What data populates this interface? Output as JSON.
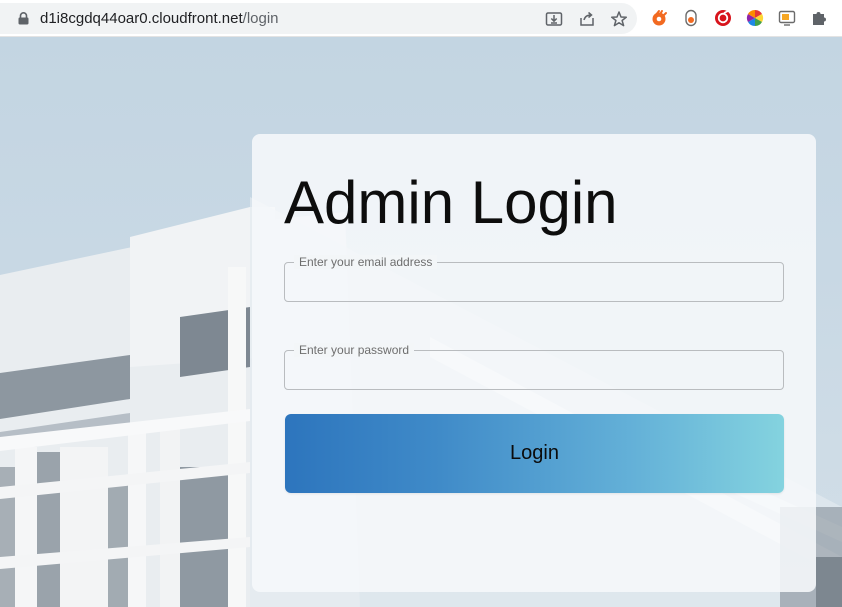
{
  "browser": {
    "url_host": "d1i8cgdq44oar0.cloudfront.net",
    "url_path": "/login",
    "icons": {
      "lock": "lock-icon",
      "install": "install-app-icon",
      "share": "share-icon",
      "bookmark": "star-icon",
      "extensions": [
        "swirl-extension-icon",
        "capsule-extension-icon",
        "red-circle-extension-icon",
        "color-wheel-extension-icon",
        "screen-extension-icon",
        "puzzle-icon"
      ]
    }
  },
  "login": {
    "title": "Admin Login",
    "email_label": "Enter your email address",
    "email_value": "",
    "password_label": "Enter your password",
    "password_value": "",
    "button_label": "Login"
  },
  "colors": {
    "button_gradient_start": "#2d75bd",
    "button_gradient_end": "#84d3df",
    "background_sky": "#c3d5e2"
  }
}
